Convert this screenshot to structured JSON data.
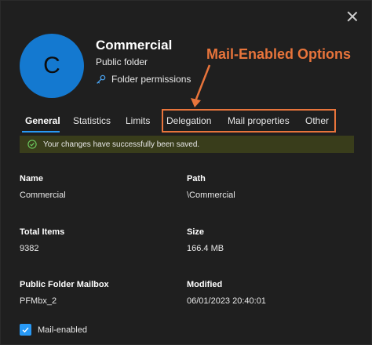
{
  "header": {
    "avatar_letter": "C",
    "title": "Commercial",
    "subtitle": "Public folder",
    "permissions_link": "Folder permissions"
  },
  "annotation": {
    "text": "Mail-Enabled Options",
    "color": "#e8743b"
  },
  "tabs": [
    {
      "label": "General",
      "active": true
    },
    {
      "label": "Statistics",
      "active": false
    },
    {
      "label": "Limits",
      "active": false
    },
    {
      "label": "Delegation",
      "active": false
    },
    {
      "label": "Mail properties",
      "active": false
    },
    {
      "label": "Other",
      "active": false
    }
  ],
  "notification": {
    "text": "Your changes have successfully been saved.",
    "type": "success"
  },
  "fields": {
    "name": {
      "label": "Name",
      "value": "Commercial"
    },
    "path": {
      "label": "Path",
      "value": "\\Commercial"
    },
    "total_items": {
      "label": "Total Items",
      "value": "9382"
    },
    "size": {
      "label": "Size",
      "value": "166.4 MB"
    },
    "mailbox": {
      "label": "Public Folder Mailbox",
      "value": "PFMbx_2"
    },
    "modified": {
      "label": "Modified",
      "value": "06/01/2023 20:40:01"
    }
  },
  "mail_enabled": {
    "label": "Mail-enabled",
    "checked": true
  },
  "colors": {
    "background": "#1f1f1f",
    "accent": "#2899f5",
    "avatar": "#1479d0",
    "success_bg": "#393d1b",
    "success_icon": "#6ccb5f"
  }
}
